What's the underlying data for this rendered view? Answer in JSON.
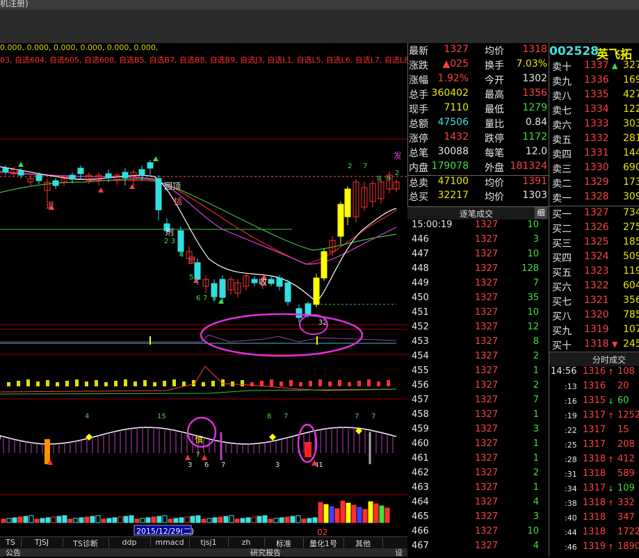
{
  "window": {
    "title_fragment": "机注册)"
  },
  "chart": {
    "indicator_values": "0.000, 0.000, 0.000, 0.000, 0.000, 0.000,",
    "watchlists": "03, 自选604, 自选605, 自选608, 自选B5, 自选B7, 自选B8, 自选B9, 自选J3, 自选L1, 自选L5, 自选L6, 自选L7, 自选L8, 自",
    "annotations": {
      "yuanding": "圆顶",
      "cha": "插",
      "tui": "退",
      "xing": "刑",
      "shu": "鼠",
      "shou": "收",
      "qi": "七",
      "tu": "突",
      "fa": "发",
      "zhen": "慎",
      "q": "?"
    },
    "numbers": [
      "2",
      "3",
      "4",
      "5",
      "6",
      "7",
      "8",
      "9",
      "1",
      "32",
      "15",
      "4",
      "8",
      "7",
      "7",
      "3",
      "6",
      "7",
      "3",
      "41"
    ],
    "date_label": "2015/12/29(二)",
    "x_marker": "02",
    "colors": {
      "up_candle": "#ff3030",
      "down_candle": "#30e0e0",
      "yellow_candle": "#ffff00",
      "ma_white": "#ffffff",
      "ma_magenta": "#e040e0",
      "ma_green": "#40c040",
      "ma_red": "#c02020",
      "circle": "#e030e0"
    }
  },
  "tabs": [
    "TS",
    "TJSJ",
    "TS诊断",
    "ddp",
    "mmacd",
    "tjsj1",
    "zh",
    "标准",
    "量化1号",
    "其他"
  ],
  "bottom": {
    "left": "公告",
    "mid": "研究报告",
    "right": "设"
  },
  "quote": {
    "rows": [
      {
        "l1": "最新",
        "v1": "1327",
        "c1": "red",
        "l2": "均价",
        "v2": "1318",
        "c2": "red"
      },
      {
        "l1": "涨跌",
        "v1": "▲025",
        "c1": "red",
        "l2": "换手",
        "v2": "7.03%",
        "c2": "yel"
      },
      {
        "l1": "涨幅",
        "v1": "1.92%",
        "c1": "red",
        "l2": "今开",
        "v2": "1302",
        "c2": "wht"
      },
      {
        "l1": "总手",
        "v1": "360402",
        "c1": "yel",
        "l2": "最高",
        "v2": "1356",
        "c2": "red"
      },
      {
        "l1": "现手",
        "v1": "7110",
        "c1": "yel",
        "l2": "最低",
        "v2": "1279",
        "c2": "grn"
      },
      {
        "l1": "总额",
        "v1": "47506",
        "c1": "cyn",
        "l2": "量比",
        "v2": "0.84",
        "c2": "wht"
      },
      {
        "l1": "涨停",
        "v1": "1432",
        "c1": "red",
        "l2": "跌停",
        "v2": "1172",
        "c2": "grn"
      },
      {
        "l1": "总笔",
        "v1": "30088",
        "c1": "wht",
        "l2": "每笔",
        "v2": "12.0",
        "c2": "wht"
      },
      {
        "l1": "内盘",
        "v1": "179078",
        "c1": "grn",
        "l2": "外盘",
        "v2": "181324",
        "c2": "red"
      },
      {
        "l1": "总卖",
        "v1": "47100",
        "c1": "yel",
        "l2": "均价",
        "v2": "1391",
        "c2": "red"
      },
      {
        "l1": "总买",
        "v1": "32217",
        "c1": "yel",
        "l2": "均价",
        "v2": "1303",
        "c2": "wht"
      }
    ]
  },
  "trades_panel": {
    "title": "逐笔成交",
    "button": "细",
    "rows": [
      {
        "t": "15:00:19",
        "p": "1327",
        "v": "10",
        "c": "grn"
      },
      {
        "t": "446",
        "p": "1327",
        "v": "3",
        "c": "grn"
      },
      {
        "t": "447",
        "p": "1327",
        "v": "10",
        "c": "grn"
      },
      {
        "t": "448",
        "p": "1327",
        "v": "128",
        "c": "grn"
      },
      {
        "t": "449",
        "p": "1327",
        "v": "7",
        "c": "grn"
      },
      {
        "t": "450",
        "p": "1327",
        "v": "35",
        "c": "grn"
      },
      {
        "t": "451",
        "p": "1327",
        "v": "10",
        "c": "grn"
      },
      {
        "t": "452",
        "p": "1327",
        "v": "12",
        "c": "grn"
      },
      {
        "t": "453",
        "p": "1327",
        "v": "8",
        "c": "grn"
      },
      {
        "t": "454",
        "p": "1327",
        "v": "2",
        "c": "grn"
      },
      {
        "t": "455",
        "p": "1327",
        "v": "1",
        "c": "grn"
      },
      {
        "t": "456",
        "p": "1327",
        "v": "2",
        "c": "grn"
      },
      {
        "t": "457",
        "p": "1327",
        "v": "7",
        "c": "grn"
      },
      {
        "t": "458",
        "p": "1327",
        "v": "1",
        "c": "grn"
      },
      {
        "t": "459",
        "p": "1327",
        "v": "3",
        "c": "grn"
      },
      {
        "t": "460",
        "p": "1327",
        "v": "1",
        "c": "grn"
      },
      {
        "t": "461",
        "p": "1327",
        "v": "1",
        "c": "grn"
      },
      {
        "t": "462",
        "p": "1327",
        "v": "2",
        "c": "grn"
      },
      {
        "t": "463",
        "p": "1327",
        "v": "1",
        "c": "grn"
      },
      {
        "t": "464",
        "p": "1327",
        "v": "4",
        "c": "grn"
      },
      {
        "t": "465",
        "p": "1327",
        "v": "3",
        "c": "grn"
      },
      {
        "t": "466",
        "p": "1327",
        "v": "10",
        "c": "grn"
      },
      {
        "t": "467",
        "p": "1327",
        "v": "4",
        "c": "grn"
      }
    ]
  },
  "stock": {
    "code": "002528",
    "name": "英飞拓"
  },
  "book": {
    "rows": [
      {
        "l": "卖十",
        "p": "1337",
        "pc": "red",
        "a": "▲",
        "ac": "grn",
        "q": "327"
      },
      {
        "l": "卖九",
        "p": "1336",
        "pc": "red",
        "a": "",
        "ac": "",
        "q": "169"
      },
      {
        "l": "卖八",
        "p": "1335",
        "pc": "red",
        "a": "",
        "ac": "",
        "q": "427"
      },
      {
        "l": "卖七",
        "p": "1334",
        "pc": "red",
        "a": "",
        "ac": "",
        "q": "122"
      },
      {
        "l": "卖六",
        "p": "1333",
        "pc": "red",
        "a": "",
        "ac": "",
        "q": "303"
      },
      {
        "l": "卖五",
        "p": "1332",
        "pc": "red",
        "a": "",
        "ac": "",
        "q": "281"
      },
      {
        "l": "卖四",
        "p": "1331",
        "pc": "red",
        "a": "",
        "ac": "",
        "q": "144"
      },
      {
        "l": "卖三",
        "p": "1330",
        "pc": "red",
        "a": "",
        "ac": "",
        "q": "690"
      },
      {
        "l": "卖二",
        "p": "1329",
        "pc": "red",
        "a": "",
        "ac": "",
        "q": "173"
      },
      {
        "l": "卖一",
        "p": "1328",
        "pc": "red",
        "a": "",
        "ac": "",
        "q": "309"
      },
      {
        "l": "买一",
        "p": "1327",
        "pc": "red",
        "a": "",
        "ac": "",
        "q": "734"
      },
      {
        "l": "买二",
        "p": "1326",
        "pc": "red",
        "a": "",
        "ac": "",
        "q": "2757"
      },
      {
        "l": "买三",
        "p": "1325",
        "pc": "red",
        "a": "",
        "ac": "",
        "q": "1859"
      },
      {
        "l": "买四",
        "p": "1324",
        "pc": "red",
        "a": "",
        "ac": "",
        "q": "5098"
      },
      {
        "l": "买五",
        "p": "1323",
        "pc": "red",
        "a": "",
        "ac": "",
        "q": "1193"
      },
      {
        "l": "买六",
        "p": "1322",
        "pc": "red",
        "a": "",
        "ac": "",
        "q": "604"
      },
      {
        "l": "买七",
        "p": "1321",
        "pc": "red",
        "a": "",
        "ac": "",
        "q": "356"
      },
      {
        "l": "买八",
        "p": "1320",
        "pc": "red",
        "a": "",
        "ac": "",
        "q": "785"
      },
      {
        "l": "买九",
        "p": "1319",
        "pc": "red",
        "a": "",
        "ac": "",
        "q": "107"
      },
      {
        "l": "买十",
        "p": "1318",
        "pc": "red",
        "a": "▼",
        "ac": "red",
        "q": "2458"
      }
    ]
  },
  "ticks_panel": {
    "title": "分时成交",
    "rows": [
      {
        "t": "14:56",
        "s": false,
        "p": "1316",
        "a": "↑",
        "ac": "red",
        "v": "108",
        "vc": "red"
      },
      {
        "t": ":13",
        "s": true,
        "p": "1316",
        "a": "",
        "ac": "",
        "v": "20",
        "vc": "red"
      },
      {
        "t": ":16",
        "s": true,
        "p": "1315",
        "a": "↓",
        "ac": "grn",
        "v": "60",
        "vc": "grn"
      },
      {
        "t": ":19",
        "s": true,
        "p": "1317",
        "a": "↑",
        "ac": "red",
        "v": "1252",
        "vc": "red"
      },
      {
        "t": ":22",
        "s": true,
        "p": "1317",
        "a": "",
        "ac": "",
        "v": "15",
        "vc": "red"
      },
      {
        "t": ":25",
        "s": true,
        "p": "1317",
        "a": "",
        "ac": "",
        "v": "208",
        "vc": "red"
      },
      {
        "t": ":28",
        "s": true,
        "p": "1318",
        "a": "↑",
        "ac": "red",
        "v": "412",
        "vc": "red"
      },
      {
        "t": ":31",
        "s": true,
        "p": "1318",
        "a": "",
        "ac": "",
        "v": "589",
        "vc": "red"
      },
      {
        "t": ":34",
        "s": true,
        "p": "1317",
        "a": "↓",
        "ac": "grn",
        "v": "109",
        "vc": "grn"
      },
      {
        "t": ":38",
        "s": true,
        "p": "1318",
        "a": "↑",
        "ac": "red",
        "v": "332",
        "vc": "red"
      },
      {
        "t": ":40",
        "s": true,
        "p": "1318",
        "a": "",
        "ac": "",
        "v": "347",
        "vc": "red"
      },
      {
        "t": ":44",
        "s": true,
        "p": "1318",
        "a": "",
        "ac": "",
        "v": "1722",
        "vc": "red"
      },
      {
        "t": ":46",
        "s": true,
        "p": "1319",
        "a": "↑",
        "ac": "red",
        "v": "1890",
        "vc": "red"
      }
    ]
  }
}
